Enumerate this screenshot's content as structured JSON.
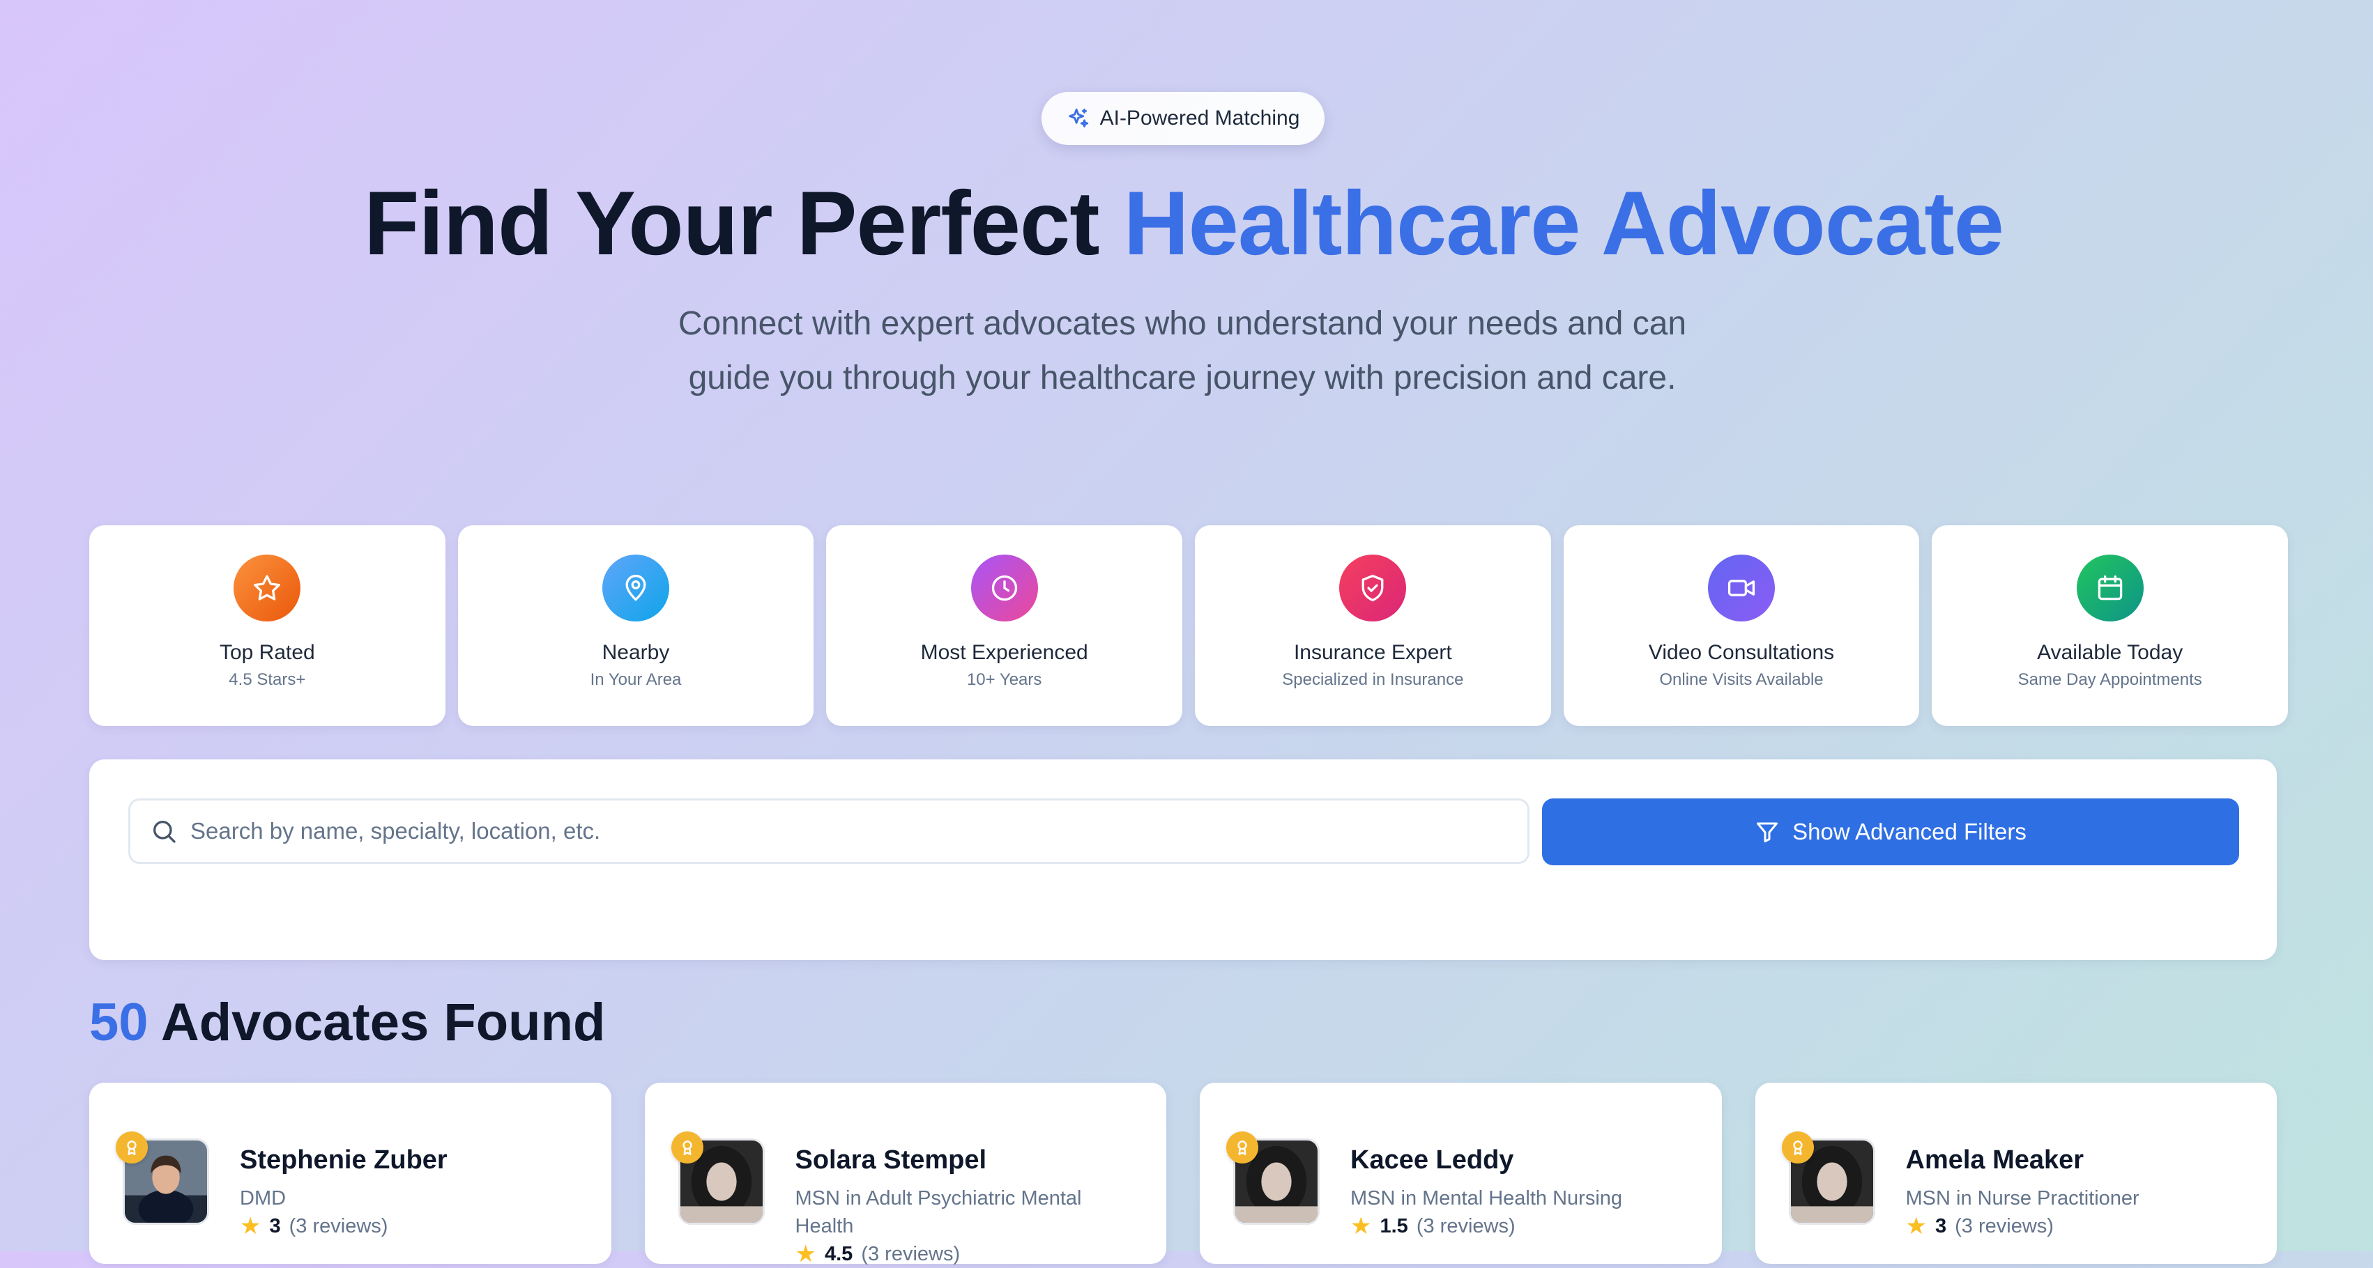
{
  "hero": {
    "badge": "AI-Powered Matching",
    "title_plain": "Find Your Perfect ",
    "title_accent": "Healthcare Advocate",
    "subtitle": "Connect with expert advocates who understand your needs and can guide you through your healthcare journey with precision and care."
  },
  "features": [
    {
      "title": "Top Rated",
      "subtitle": "4.5 Stars+",
      "icon": "star-icon",
      "color": "orange"
    },
    {
      "title": "Nearby",
      "subtitle": "In Your Area",
      "icon": "map-pin-icon",
      "color": "blue"
    },
    {
      "title": "Most Experienced",
      "subtitle": "10+ Years",
      "icon": "clock-icon",
      "color": "purple"
    },
    {
      "title": "Insurance Expert",
      "subtitle": "Specialized in Insurance",
      "icon": "shield-check-icon",
      "color": "red"
    },
    {
      "title": "Video Consultations",
      "subtitle": "Online Visits Available",
      "icon": "video-icon",
      "color": "indigo"
    },
    {
      "title": "Available Today",
      "subtitle": "Same Day Appointments",
      "icon": "calendar-icon",
      "color": "green"
    }
  ],
  "search": {
    "placeholder": "Search by name, specialty, location, etc.",
    "value": "",
    "filter_button": "Show Advanced Filters"
  },
  "results": {
    "count": "50",
    "label": "Advocates Found"
  },
  "advocates": [
    {
      "name": "Stephenie Zuber",
      "credential": "DMD",
      "rating": "3",
      "reviews": "(3 reviews)"
    },
    {
      "name": "Solara Stempel",
      "credential": "MSN in Adult Psychiatric Mental Health",
      "rating": "4.5",
      "reviews": "(3 reviews)"
    },
    {
      "name": "Kacee Leddy",
      "credential": "MSN in Mental Health Nursing",
      "rating": "1.5",
      "reviews": "(3 reviews)"
    },
    {
      "name": "Amela Meaker",
      "credential": "MSN in Nurse Practitioner",
      "rating": "3",
      "reviews": "(3 reviews)"
    }
  ],
  "colors": {
    "accent": "#3b6fe6",
    "button": "#2f6fe4",
    "star": "#fbbf24",
    "award": "#f5b62f"
  }
}
